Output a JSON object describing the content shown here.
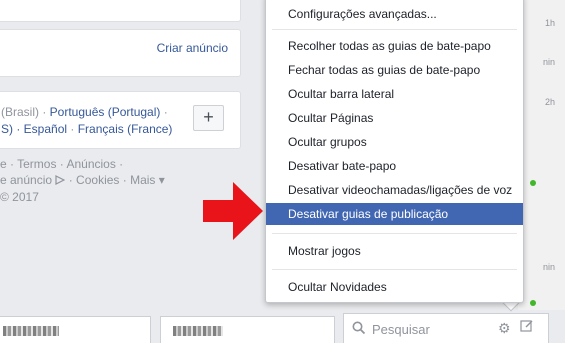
{
  "ads": {
    "create_ad": "Criar anúncio"
  },
  "languages": {
    "line1_gray": "(Brasil) · ",
    "line1_link": "Português (Portugal)",
    "line1_tail": " ·",
    "line2_gray": "S) · ",
    "line2_link1": "Español",
    "line2_sep": " · ",
    "line2_link2": "Français (France)",
    "add_button": "+"
  },
  "footer": {
    "line1": "e · Termos · Anúncios ·",
    "line2_a": "e anúncio",
    "line2_b": " · Cookies · Mais ▾",
    "line3": "© 2017"
  },
  "chat": {
    "times": [
      "1h",
      "nin",
      "2h",
      "nin"
    ],
    "partial_name": "Nathalia Bonfim Ber",
    "search_placeholder": "Pesquisar"
  },
  "menu": {
    "top_item": "Configurações avançadas...",
    "items": [
      "Recolher todas as guias de bate-papo",
      "Fechar todas as guias de bate-papo",
      "Ocultar barra lateral",
      "Ocultar Páginas",
      "Ocultar grupos",
      "Desativar bate-papo",
      "Desativar videochamadas/ligações de voz",
      "Desativar guias de publicação"
    ],
    "games": "Mostrar jogos",
    "news": "Ocultar Novidades"
  },
  "colors": {
    "accent": "#4267b2",
    "arrow": "#e8141a",
    "online": "#42b72a"
  }
}
